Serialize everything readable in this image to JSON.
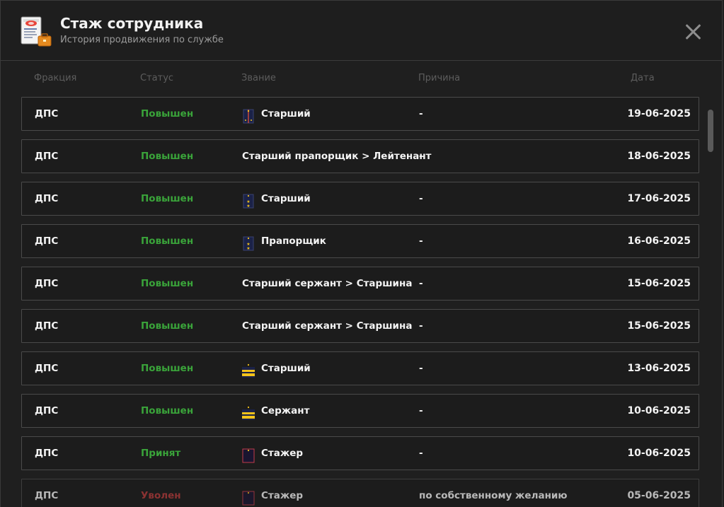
{
  "header": {
    "title": "Стаж сотрудника",
    "subtitle": "История продвижения по службе",
    "icon": "document-briefcase-icon"
  },
  "columns": {
    "faction": "Фракция",
    "status": "Статус",
    "rank": "Звание",
    "reason": "Причина",
    "date": "Дата"
  },
  "rows": [
    {
      "faction": "ДПС",
      "status": "Повышен",
      "status_type": "promoted",
      "rank_icon": "epaulette-navy-stripe-icon",
      "rank": "Старший",
      "reason": "-",
      "date": "19-06-2025"
    },
    {
      "faction": "ДПС",
      "status": "Повышен",
      "status_type": "promoted",
      "rank_icon": "",
      "rank": "Старший прапорщик > Лейтенант",
      "reason": "-",
      "date": "18-06-2025"
    },
    {
      "faction": "ДПС",
      "status": "Повышен",
      "status_type": "promoted",
      "rank_icon": "epaulette-navy-stars-icon",
      "rank": "Старший",
      "reason": "-",
      "date": "17-06-2025"
    },
    {
      "faction": "ДПС",
      "status": "Повышен",
      "status_type": "promoted",
      "rank_icon": "epaulette-navy-stars-icon",
      "rank": "Прапорщик",
      "reason": "-",
      "date": "16-06-2025"
    },
    {
      "faction": "ДПС",
      "status": "Повышен",
      "status_type": "promoted",
      "rank_icon": "",
      "rank": "Старший сержант > Старшина",
      "reason": "-",
      "date": "15-06-2025"
    },
    {
      "faction": "ДПС",
      "status": "Повышен",
      "status_type": "promoted",
      "rank_icon": "",
      "rank": "Старший сержант > Старшина",
      "reason": "-",
      "date": "15-06-2025"
    },
    {
      "faction": "ДПС",
      "status": "Повышен",
      "status_type": "promoted",
      "rank_icon": "chevron-gold-icon",
      "rank": "Старший",
      "reason": "-",
      "date": "13-06-2025"
    },
    {
      "faction": "ДПС",
      "status": "Повышен",
      "status_type": "promoted",
      "rank_icon": "chevron-gold-icon",
      "rank": "Сержант",
      "reason": "-",
      "date": "10-06-2025"
    },
    {
      "faction": "ДПС",
      "status": "Принят",
      "status_type": "hired",
      "rank_icon": "epaulette-plain-icon",
      "rank": "Стажер",
      "reason": "-",
      "date": "10-06-2025"
    },
    {
      "faction": "ДПС",
      "status": "Уволен",
      "status_type": "fired",
      "rank_icon": "epaulette-plain-icon",
      "rank": "Стажер",
      "reason": "по собственному желанию",
      "date": "05-06-2025"
    }
  ],
  "colors": {
    "promoted": "#3aa43a",
    "fired": "#b53a3a",
    "gold": "#f2c21a",
    "navy": "#1b2248"
  }
}
